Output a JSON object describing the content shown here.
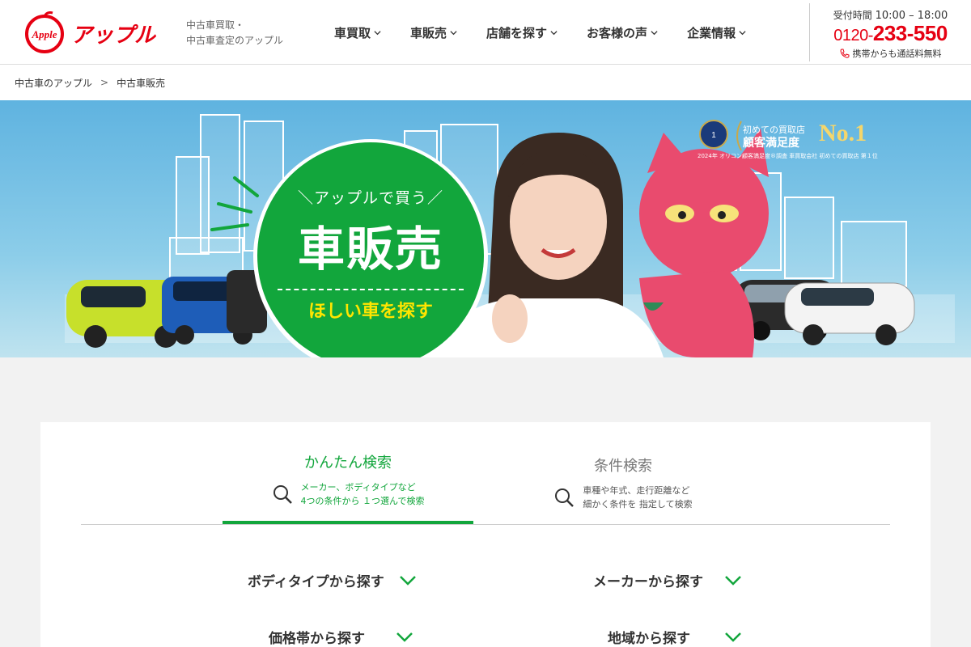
{
  "header": {
    "logo_text": "アップル",
    "tagline_line1": "中古車買取・",
    "tagline_line2": "中古車査定のアップル",
    "nav": [
      {
        "label": "車買取"
      },
      {
        "label": "車販売"
      },
      {
        "label": "店舗を探す"
      },
      {
        "label": "お客様の声"
      },
      {
        "label": "企業情報"
      }
    ],
    "hours_label": "受付時間",
    "hours_value": "10:00 – 18:00",
    "phone_prefix": "0120-",
    "phone_main": "233-550",
    "phone_note": "携帯からも通話料無料"
  },
  "breadcrumb": {
    "items": [
      "中古車のアップル",
      "中古車販売"
    ],
    "separator": ">"
  },
  "hero": {
    "subtitle": "＼アップルで買う／",
    "title": "車販売",
    "cta": "ほしい車を探す",
    "award_line1": "初めての買取店",
    "award_line2": "顧客満足度",
    "award_rank": "No.1",
    "award_note": "2024年 オリコン顧客満足度®調査 車買取会社 初めての買取店 第１位"
  },
  "search": {
    "tabs": [
      {
        "title": "かんたん検索",
        "desc_line1": "メーカー、ボディタイプなど",
        "desc_line2": "4つの条件から １つ選んで検索",
        "active": true
      },
      {
        "title": "条件検索",
        "desc_line1": "車種や年式、走行距離など",
        "desc_line2": "細かく条件を 指定して検索",
        "active": false
      }
    ],
    "options": [
      {
        "label": "ボディタイプから探す"
      },
      {
        "label": "メーカーから探す"
      },
      {
        "label": "価格帯から探す"
      },
      {
        "label": "地域から探す"
      }
    ]
  },
  "colors": {
    "brand_red": "#e60012",
    "accent_green": "#12a63c",
    "cta_yellow": "#ffe500"
  }
}
